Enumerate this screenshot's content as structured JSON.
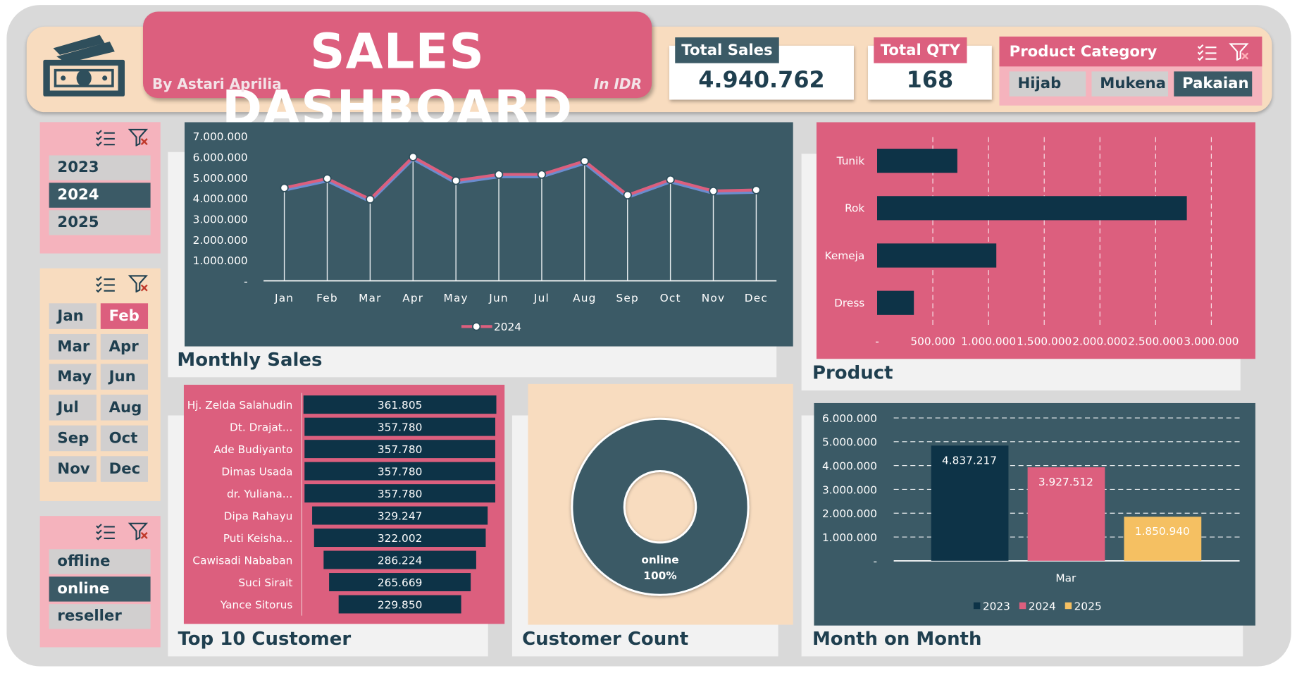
{
  "header": {
    "title": "SALES DASHBOARD",
    "author": "By Astari Aprilia",
    "currency_note": "In IDR"
  },
  "kpi": {
    "total_sales_label": "Total Sales",
    "total_sales_value": "4.940.762",
    "total_qty_label": "Total QTY",
    "total_qty_value": "168"
  },
  "category": {
    "label": "Product Category",
    "options": [
      {
        "label": "Hijab",
        "selected": false
      },
      {
        "label": "Mukena",
        "selected": false
      },
      {
        "label": "Pakaian",
        "selected": true
      }
    ]
  },
  "year_slicer": {
    "options": [
      {
        "label": "2023",
        "selected": false
      },
      {
        "label": "2024",
        "selected": true
      },
      {
        "label": "2025",
        "selected": false
      }
    ]
  },
  "month_slicer": {
    "options": [
      {
        "label": "Jan",
        "selected": false
      },
      {
        "label": "Feb",
        "selected": true
      },
      {
        "label": "Mar",
        "selected": false
      },
      {
        "label": "Apr",
        "selected": false
      },
      {
        "label": "May",
        "selected": false
      },
      {
        "label": "Jun",
        "selected": false
      },
      {
        "label": "Jul",
        "selected": false
      },
      {
        "label": "Aug",
        "selected": false
      },
      {
        "label": "Sep",
        "selected": false
      },
      {
        "label": "Oct",
        "selected": false
      },
      {
        "label": "Nov",
        "selected": false
      },
      {
        "label": "Dec",
        "selected": false
      }
    ]
  },
  "channel_slicer": {
    "options": [
      {
        "label": "offline",
        "selected": false
      },
      {
        "label": "online",
        "selected": true
      },
      {
        "label": "reseller",
        "selected": false
      }
    ]
  },
  "sections": {
    "monthly_sales": "Monthly Sales",
    "product": "Product",
    "top10": "Top 10 Customer",
    "customer_count": "Customer Count",
    "mom": "Month on Month"
  },
  "colors": {
    "teal": "#3b5a66",
    "navy": "#0d3347",
    "pink": "#dc5f7e",
    "peach": "#f8dcbf",
    "yellow": "#f5c062"
  },
  "chart_data": [
    {
      "id": "monthly",
      "type": "line",
      "categories": [
        "Jan",
        "Feb",
        "Mar",
        "Apr",
        "May",
        "Jun",
        "Jul",
        "Aug",
        "Sep",
        "Oct",
        "Nov",
        "Dec"
      ],
      "series": [
        {
          "name": "2024",
          "values": [
            4500000,
            4950000,
            3950000,
            6000000,
            4850000,
            5150000,
            5150000,
            5800000,
            4150000,
            4900000,
            4350000,
            4400000
          ]
        }
      ],
      "ylim": [
        0,
        7000000
      ],
      "yticks": [
        "-",
        "1.000.000",
        "2.000.000",
        "3.000.000",
        "4.000.000",
        "5.000.000",
        "6.000.000",
        "7.000.000"
      ],
      "legend": "bottom"
    },
    {
      "id": "product",
      "type": "bar",
      "orientation": "horizontal",
      "categories": [
        "Tunik",
        "Rok",
        "Kemeja",
        "Dress"
      ],
      "values": [
        720000,
        2780000,
        1070000,
        330000
      ],
      "xlim": [
        0,
        3000000
      ],
      "xticks": [
        "-",
        "500.000",
        "1.000.000",
        "1.500.000",
        "2.000.000",
        "2.500.000",
        "3.000.000"
      ]
    },
    {
      "id": "top10",
      "type": "bar",
      "orientation": "horizontal",
      "categories": [
        "Hj. Zelda Salahudin",
        "Dt. Drajat...",
        "Ade Budiyanto",
        "Dimas Usada",
        "dr. Yuliana...",
        "Dipa Rahayu",
        "Puti Keisha...",
        "Cawisadi Nababan",
        "Suci Sirait",
        "Yance Sitorus"
      ],
      "values": [
        361805,
        357780,
        357780,
        357780,
        357780,
        329247,
        322002,
        286224,
        265669,
        229850
      ],
      "labels": [
        "361.805",
        "357.780",
        "357.780",
        "357.780",
        "357.780",
        "329.247",
        "322.002",
        "286.224",
        "265.669",
        "229.850"
      ]
    },
    {
      "id": "customer_count",
      "type": "pie",
      "categories": [
        "online"
      ],
      "values": [
        100
      ],
      "labels": [
        "online",
        "100%"
      ]
    },
    {
      "id": "mom",
      "type": "bar",
      "categories": [
        "Mar"
      ],
      "series": [
        {
          "name": "2023",
          "values": [
            4837217
          ]
        },
        {
          "name": "2024",
          "values": [
            3927512
          ]
        },
        {
          "name": "2025",
          "values": [
            1850940
          ]
        }
      ],
      "labels": [
        "4.837.217",
        "3.927.512",
        "1.850.940"
      ],
      "ylim": [
        0,
        6000000
      ],
      "yticks": [
        "-",
        "1.000.000",
        "2.000.000",
        "3.000.000",
        "4.000.000",
        "5.000.000",
        "6.000.000"
      ],
      "legend": "bottom"
    }
  ]
}
